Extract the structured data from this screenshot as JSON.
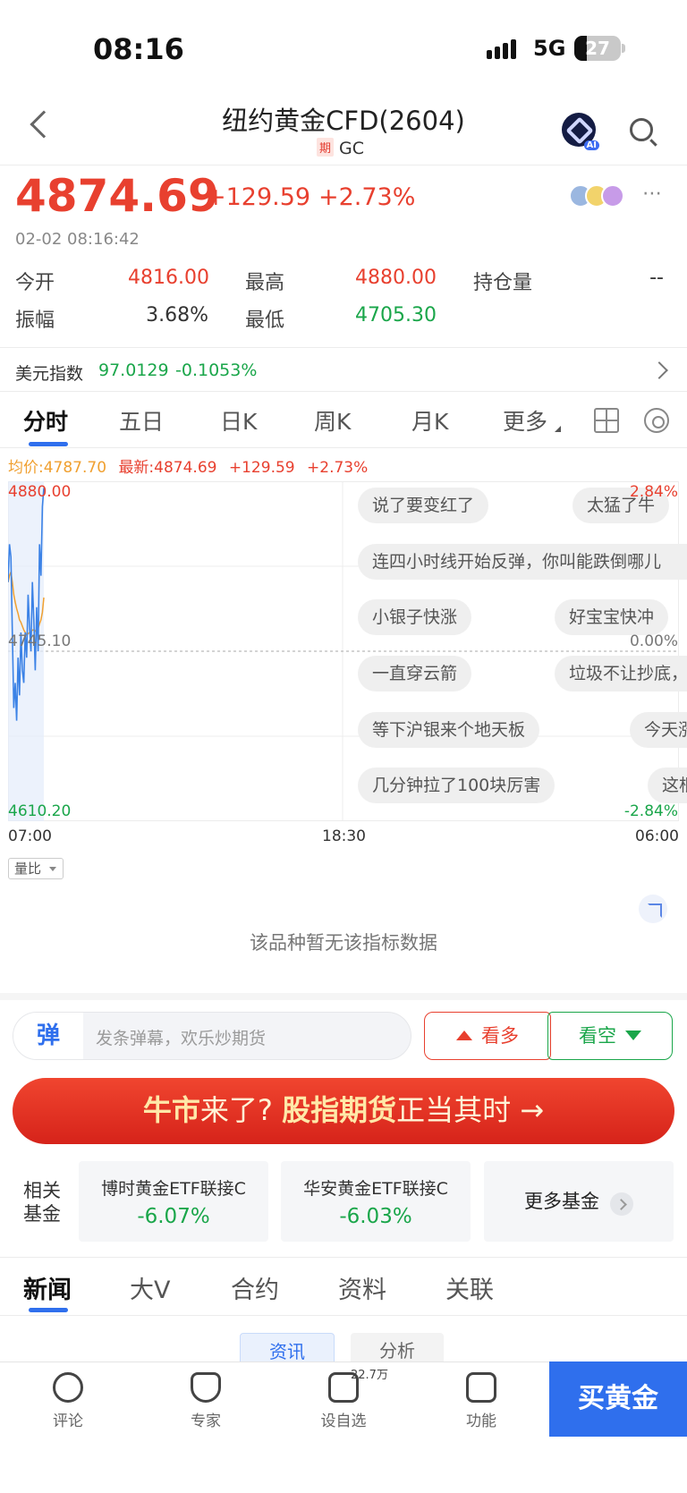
{
  "status_bar": {
    "time": "08:16",
    "network": "5G",
    "battery": "27"
  },
  "header": {
    "title": "纽约黄金CFD(2604)",
    "tag": "期",
    "code": "GC",
    "ai_badge": "AI"
  },
  "quote": {
    "price": "4874.69",
    "change": "+129.59",
    "change_pct": "+2.73%",
    "timestamp": "02-02 08:16:42",
    "stats": [
      {
        "label": "今开",
        "value": "4816.00",
        "color": "#e8402f"
      },
      {
        "label": "最高",
        "value": "4880.00",
        "color": "#e8402f"
      },
      {
        "label": "持仓量",
        "value": "--",
        "color": "#333333"
      },
      {
        "label": "振幅",
        "value": "3.68%",
        "color": "#333333"
      },
      {
        "label": "最低",
        "value": "4705.30",
        "color": "#1aa64a"
      }
    ]
  },
  "usd_index": {
    "label": "美元指数",
    "value": "97.0129",
    "change_pct": "-0.1053%"
  },
  "chart_tabs": [
    "分时",
    "五日",
    "日K",
    "周K",
    "月K",
    "更多"
  ],
  "legend": {
    "avg_label": "均价:4787.70",
    "latest_label": "最新:4874.69",
    "change": "+129.59",
    "change_pct": "+2.73%"
  },
  "chart_axis": {
    "y_top": "4880.00",
    "y_mid": "4745.10",
    "y_bottom": "4610.20",
    "pct_top": "2.84%",
    "pct_mid": "0.00%",
    "pct_bottom": "-2.84%",
    "x_labels": [
      "07:00",
      "18:30",
      "06:00"
    ]
  },
  "chart_data": {
    "type": "line",
    "ylim": [
      4610.2,
      4880.0
    ],
    "x_range": [
      "07:00",
      "06:00"
    ],
    "series": [
      {
        "name": "最新",
        "color": "#3b82e6",
        "values": [
          4800,
          4830,
          4820,
          4760,
          4700,
          4720,
          4690,
          4740,
          4710,
          4760,
          4730,
          4720,
          4760,
          4740,
          4790,
          4765,
          4745,
          4800,
          4770,
          4730,
          4780,
          4745,
          4830,
          4805,
          4860,
          4874.69
        ]
      },
      {
        "name": "均价",
        "color": "#f0a030",
        "values": [
          4800,
          4805,
          4808,
          4800,
          4790,
          4784,
          4779,
          4775,
          4770,
          4768,
          4765,
          4762,
          4760,
          4758,
          4759,
          4760,
          4760,
          4762,
          4762,
          4761,
          4763,
          4763,
          4767,
          4770,
          4776,
          4787.7
        ]
      }
    ]
  },
  "danmu": [
    "说了要变红了",
    "太猛了牛",
    "连四小时线开始反弹，你叫能跌倒哪儿",
    "小银子快涨",
    "好宝宝快冲",
    "一直穿云箭",
    "垃圾不让抄底，",
    "等下沪银来个地天板",
    "今天涨",
    "几分钟拉了100块厉害",
    "这根"
  ],
  "volume_button": "量比",
  "no_data_text": "该品种暂无该指标数据",
  "comment_bar": {
    "logo": "弹",
    "placeholder": "发条弹幕，欢乐炒期货",
    "bull_label": "看多",
    "bear_label": "看空"
  },
  "banner": {
    "part1": "牛市",
    "part2": "来了? ",
    "part3": "股指期货",
    "part4": "正当其时 →"
  },
  "funds": {
    "label": "相关基金",
    "items": [
      {
        "name": "博时黄金ETF联接C",
        "pct": "-6.07%"
      },
      {
        "name": "华安黄金ETF联接C",
        "pct": "-6.03%"
      }
    ],
    "more": "更多基金"
  },
  "news_tabs": [
    "新闻",
    "大V",
    "合约",
    "资料",
    "关联"
  ],
  "sub_tabs": [
    "资讯",
    "分析"
  ],
  "bottom_nav": [
    {
      "label": "评论",
      "icon": "comment-icon"
    },
    {
      "label": "专家",
      "icon": "expert-icon"
    },
    {
      "label": "设自选",
      "icon": "watchlist-icon",
      "badge": "22.7万"
    },
    {
      "label": "功能",
      "icon": "menu-icon"
    }
  ],
  "buy_button": "买黄金"
}
